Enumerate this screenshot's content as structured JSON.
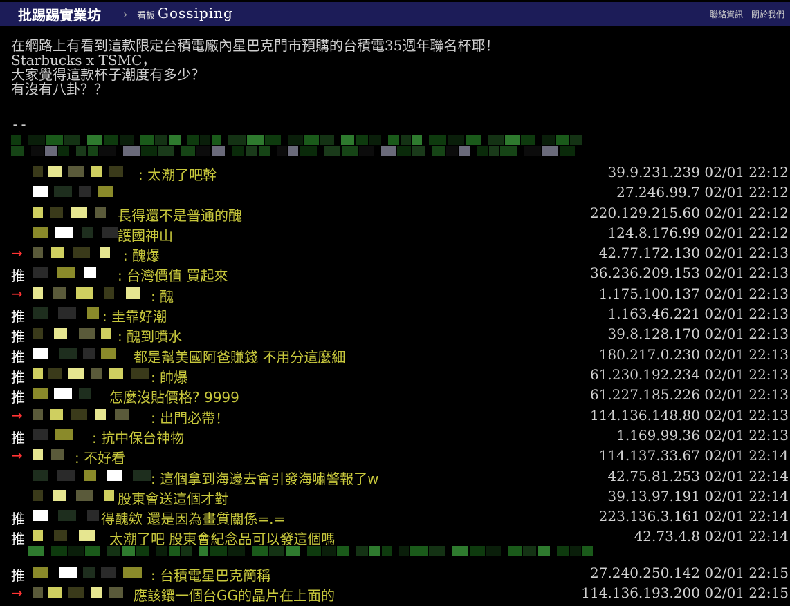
{
  "header": {
    "brand": "批踢踢實業坊",
    "separator": "›",
    "board_keyword": "看板",
    "board_name": "Gossiping",
    "links": [
      "聯絡資訊",
      "關於我們"
    ]
  },
  "article": {
    "lines": [
      "在網路上有看到這款限定台積電廠內星巴克門市預購的台積電35週年聯名杯耶！",
      "Starbucks x TSMC，",
      "大家覺得這款杯子潮度有多少？",
      "有沒有八卦？？"
    ],
    "signature": "--"
  },
  "pushes": [
    {
      "tag": "",
      "content": ": 太潮了吧幹",
      "ip": "39.9.231.239",
      "time": "02/01 22:12"
    },
    {
      "tag": "",
      "content": "",
      "ip": "27.246.99.7",
      "time": "02/01 22:12"
    },
    {
      "tag": "",
      "content": "長得還不是普通的醜",
      "ip": "220.129.215.60",
      "time": "02/01 22:12"
    },
    {
      "tag": "",
      "content": "護國神山",
      "ip": "124.8.176.99",
      "time": "02/01 22:12"
    },
    {
      "tag": "→",
      "content": ": 醜爆",
      "ip": "42.77.172.130",
      "time": "02/01 22:13"
    },
    {
      "tag": "推",
      "content": ": 台灣價值 買起來",
      "ip": "36.236.209.153",
      "time": "02/01 22:13"
    },
    {
      "tag": "→",
      "content": ": 醜",
      "ip": "1.175.100.137",
      "time": "02/01 22:13"
    },
    {
      "tag": "推",
      "content": ": 圭靠好潮",
      "ip": "1.163.46.221",
      "time": "02/01 22:13"
    },
    {
      "tag": "推",
      "content": ": 醜到噴水",
      "ip": "39.8.128.170",
      "time": "02/01 22:13"
    },
    {
      "tag": "推",
      "content": "都是幫美國阿爸賺錢 不用分這麼細",
      "ip": "180.217.0.230",
      "time": "02/01 22:13"
    },
    {
      "tag": "推",
      "content": ": 帥爆",
      "ip": "61.230.192.234",
      "time": "02/01 22:13"
    },
    {
      "tag": "推",
      "content": "怎麼沒貼價格? 9999",
      "ip": "61.227.185.226",
      "time": "02/01 22:13"
    },
    {
      "tag": "→",
      "content": ": 出門必帶！",
      "ip": "114.136.148.80",
      "time": "02/01 22:13"
    },
    {
      "tag": "推",
      "content": ": 抗中保台神物",
      "ip": "1.169.99.36",
      "time": "02/01 22:13"
    },
    {
      "tag": "→",
      "content": ": 不好看",
      "ip": "114.137.33.67",
      "time": "02/01 22:14"
    },
    {
      "tag": "",
      "content": ": 這個拿到海邊去會引發海嘯警報了w",
      "ip": "42.75.81.253",
      "time": "02/01 22:14"
    },
    {
      "tag": "",
      "content": "股東會送這個才對",
      "ip": "39.13.97.191",
      "time": "02/01 22:14"
    },
    {
      "tag": "推",
      "content": "得醜欸 還是因為畫質關係=.=",
      "ip": "223.136.3.161",
      "time": "02/01 22:14"
    },
    {
      "tag": "推",
      "content": "太潮了吧 股東會紀念品可以發這個嗎",
      "ip": "42.73.4.8",
      "time": "02/01 22:14"
    },
    {
      "tag": "推",
      "content": ": 台積電星巴克簡稱",
      "ip": "27.240.250.142",
      "time": "02/01 22:15"
    },
    {
      "tag": "→",
      "content": "應該鑲一個台GG的晶片在上面的",
      "ip": "114.136.193.200",
      "time": "02/01 22:15"
    }
  ],
  "colors": {
    "background": "#000000",
    "header_bar": "#1c1c58",
    "push_text": "#c8c83c",
    "arrow_tag": "#ff3333",
    "push_tag": "#ffffff",
    "meta_text": "#d0d0d0"
  }
}
